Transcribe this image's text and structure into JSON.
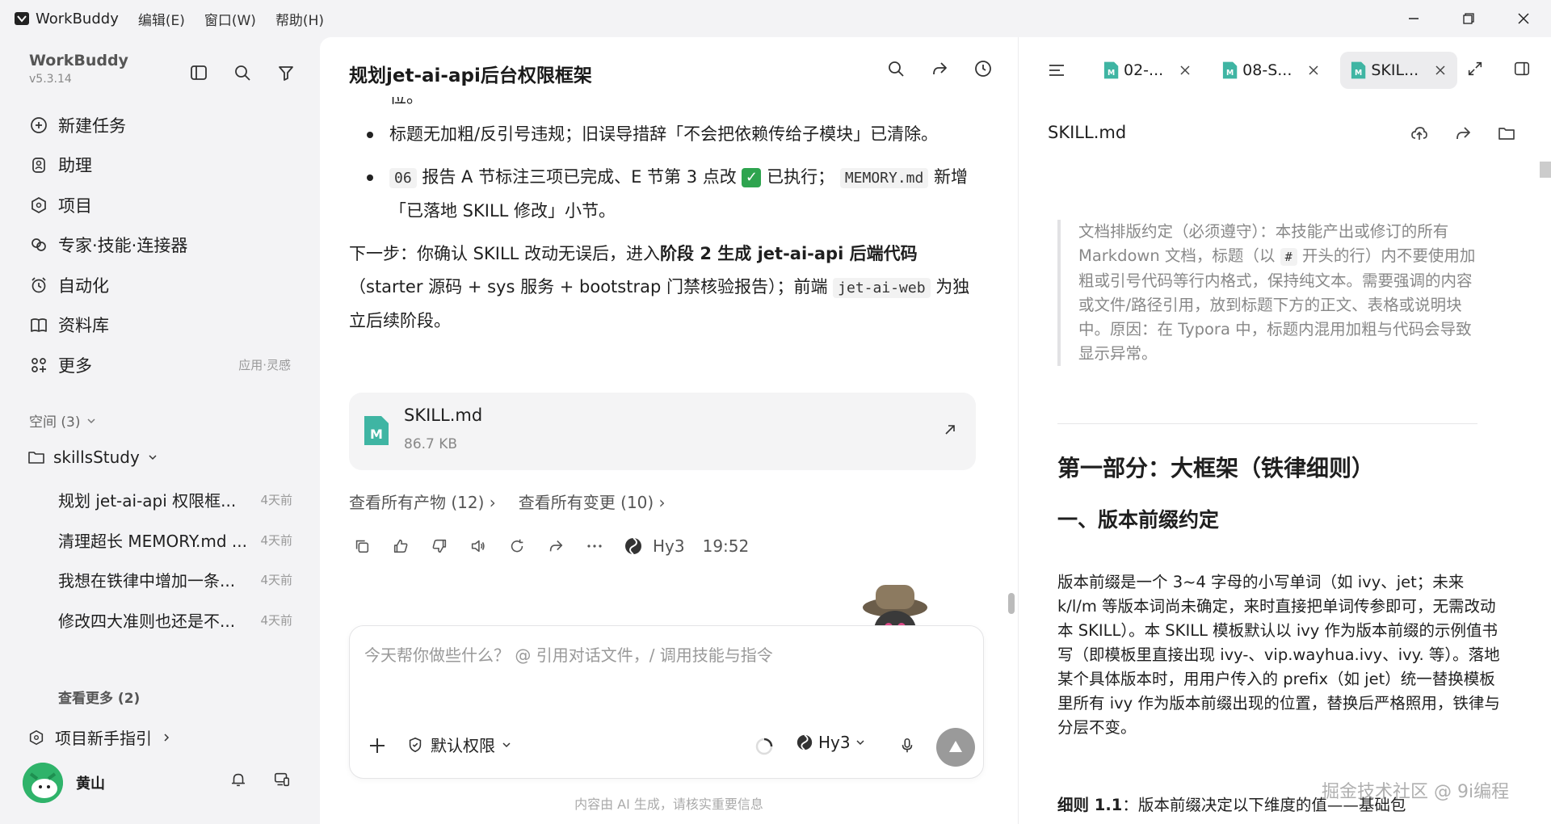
{
  "titlebar": {
    "app_name": "WorkBuddy",
    "menus": [
      "编辑(E)",
      "窗口(W)",
      "帮助(H)"
    ]
  },
  "sidebar": {
    "brand": "WorkBuddy",
    "version": "v5.3.14",
    "nav": [
      {
        "label": "新建任务",
        "icon": "plus-circle-icon"
      },
      {
        "label": "助理",
        "icon": "assistant-icon"
      },
      {
        "label": "项目",
        "icon": "project-icon"
      },
      {
        "label": "专家·技能·连接器",
        "icon": "expert-icon"
      },
      {
        "label": "自动化",
        "icon": "alarm-icon"
      },
      {
        "label": "资料库",
        "icon": "book-icon"
      },
      {
        "label": "更多",
        "icon": "grid-icon",
        "sub": "应用·灵感"
      }
    ],
    "space_header": "空间 (3)",
    "project": "skillsStudy",
    "tasks": [
      {
        "title": "规划 jet-ai-api 权限框...",
        "time": "4天前"
      },
      {
        "title": "清理超长 MEMORY.md ...",
        "time": "4天前"
      },
      {
        "title": "我想在铁律中增加一条...",
        "time": "4天前"
      },
      {
        "title": "修改四大准则也还是不...",
        "time": "4天前"
      }
    ],
    "see_more": "查看更多 (2)",
    "guide": "项目新手指引",
    "user": "黄山"
  },
  "chat": {
    "title": "规划jet-ai-api后台权限框架",
    "partial_top": "位。",
    "bullets": {
      "b1": "标题无加粗/反引号违规；旧误导措辞「不会把依赖传给子模块」已清除。",
      "b2_code1": "06",
      "b2_a": "报告 A 节标注三项已完成、E 节第 3 点改",
      "b2_b": "已执行；",
      "b2_code2": "MEMORY.md",
      "b2_c": "新增「已落地 SKILL 修改」小节。"
    },
    "next_a": "下一步：你确认 SKILL 改动无误后，进入",
    "next_bold": "阶段 2 生成 jet-ai-api 后端代码",
    "next_b": "（starter 源码 + sys 服务 + bootstrap 门禁核验报告）；前端",
    "next_code": "jet-ai-web",
    "next_c": "为独立后续阶段。",
    "file": {
      "name": "SKILL.md",
      "size": "86.7 KB"
    },
    "link_products": "查看所有产物 (12)",
    "link_changes": "查看所有变更 (10)",
    "model": "Hy3",
    "time": "19:52",
    "input_placeholder": "今天帮你做些什么？ @ 引用对话文件，/ 调用技能与指令",
    "permission": "默认权限",
    "input_model": "Hy3",
    "disclaimer": "内容由 AI 生成，请核实重要信息"
  },
  "right": {
    "tabs": [
      {
        "label": "02-...",
        "active": false
      },
      {
        "label": "08-S...",
        "active": false
      },
      {
        "label": "SKIL...",
        "active": true
      }
    ],
    "doc_title": "SKILL.md",
    "quote_a": "文档排版约定（必须遵守）：本技能产出或修订的所有 Markdown 文档，标题（以",
    "quote_code": "#",
    "quote_b": "开头的行）内不要使用加粗或引号代码等行内格式，保持纯文本。需要强调的内容或文件/路径引用，放到标题下方的正文、表格或说明块中。原因：在 Typora 中，标题内混用加粗与代码会导致显示异常。",
    "h1": "第一部分：大框架（铁律细则）",
    "h2": "一、版本前缀约定",
    "para": "版本前缀是一个 3~4 字母的小写单词（如 ivy、jet；未来 k/l/m 等版本词尚未确定，来时直接把单词传参即可，无需改动本 SKILL）。本 SKILL 模板默认以 ivy 作为版本前缀的示例值书写（即模板里直接出现 ivy-、vip.wayhua.ivy、ivy. 等）。落地某个具体版本时，用用户传入的 prefix（如 jet）统一替换模板里所有 ivy 作为版本前缀出现的位置，替换后严格照用，铁律与分层不变。",
    "rule_bold": "细则 1.1",
    "rule_text": "：版本前缀决定以下维度的值——基础包"
  },
  "watermark": "掘金技术社区 @ 9i编程",
  "colors": {
    "accent_green": "#2ea44f",
    "file_icon": "#3fb5a3",
    "send": "#9a9a9a"
  }
}
